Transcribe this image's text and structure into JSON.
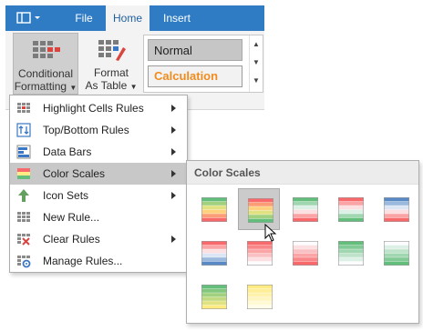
{
  "ribbon": {
    "tabs": [
      {
        "label": "File",
        "active": false
      },
      {
        "label": "Home",
        "active": true
      },
      {
        "label": "Insert",
        "active": false
      }
    ],
    "conditional_formatting": {
      "line1": "Conditional",
      "line2": "Formatting"
    },
    "format_as_table": {
      "line1": "Format",
      "line2": "As Table"
    },
    "cell_styles": [
      "Normal",
      "Calculation"
    ],
    "colors": {
      "tabbar": "#2f7cc4",
      "calculation_text": "#f08c1e"
    }
  },
  "menu": {
    "items": [
      {
        "label": "Highlight Cells Rules",
        "icon": "highlight-cells-icon",
        "submenu": true
      },
      {
        "label": "Top/Bottom Rules",
        "icon": "top-bottom-icon",
        "submenu": true
      },
      {
        "label": "Data Bars",
        "icon": "data-bars-icon",
        "submenu": true
      },
      {
        "label": "Color Scales",
        "icon": "color-scales-icon",
        "submenu": true,
        "highlighted": true
      },
      {
        "label": "Icon Sets",
        "icon": "up-arrow-icon",
        "submenu": true
      },
      {
        "label": "New Rule...",
        "icon": "new-rule-icon",
        "submenu": false
      },
      {
        "label": "Clear Rules",
        "icon": "clear-rules-icon",
        "submenu": true
      },
      {
        "label": "Manage Rules...",
        "icon": "manage-rules-icon",
        "submenu": false
      }
    ]
  },
  "color_scales": {
    "title": "Color Scales",
    "selected_index": 1,
    "items": [
      [
        "#63be7b",
        "#ffeb84",
        "#f8696b"
      ],
      [
        "#f8696b",
        "#ffeb84",
        "#63be7b"
      ],
      [
        "#63be7b",
        "#fcfcff",
        "#f8696b"
      ],
      [
        "#f8696b",
        "#fcfcff",
        "#63be7b"
      ],
      [
        "#5a8ac6",
        "#fcfcff",
        "#f8696b"
      ],
      [
        "#f8696b",
        "#fcfcff",
        "#5a8ac6"
      ],
      [
        "#f8696b",
        "#fcfcff"
      ],
      [
        "#fcfcff",
        "#f8696b"
      ],
      [
        "#63be7b",
        "#fcfcff"
      ],
      [
        "#fcfcff",
        "#63be7b"
      ],
      [
        "#63be7b",
        "#ffeb84"
      ],
      [
        "#ffeb84",
        "#fffce8"
      ]
    ]
  }
}
